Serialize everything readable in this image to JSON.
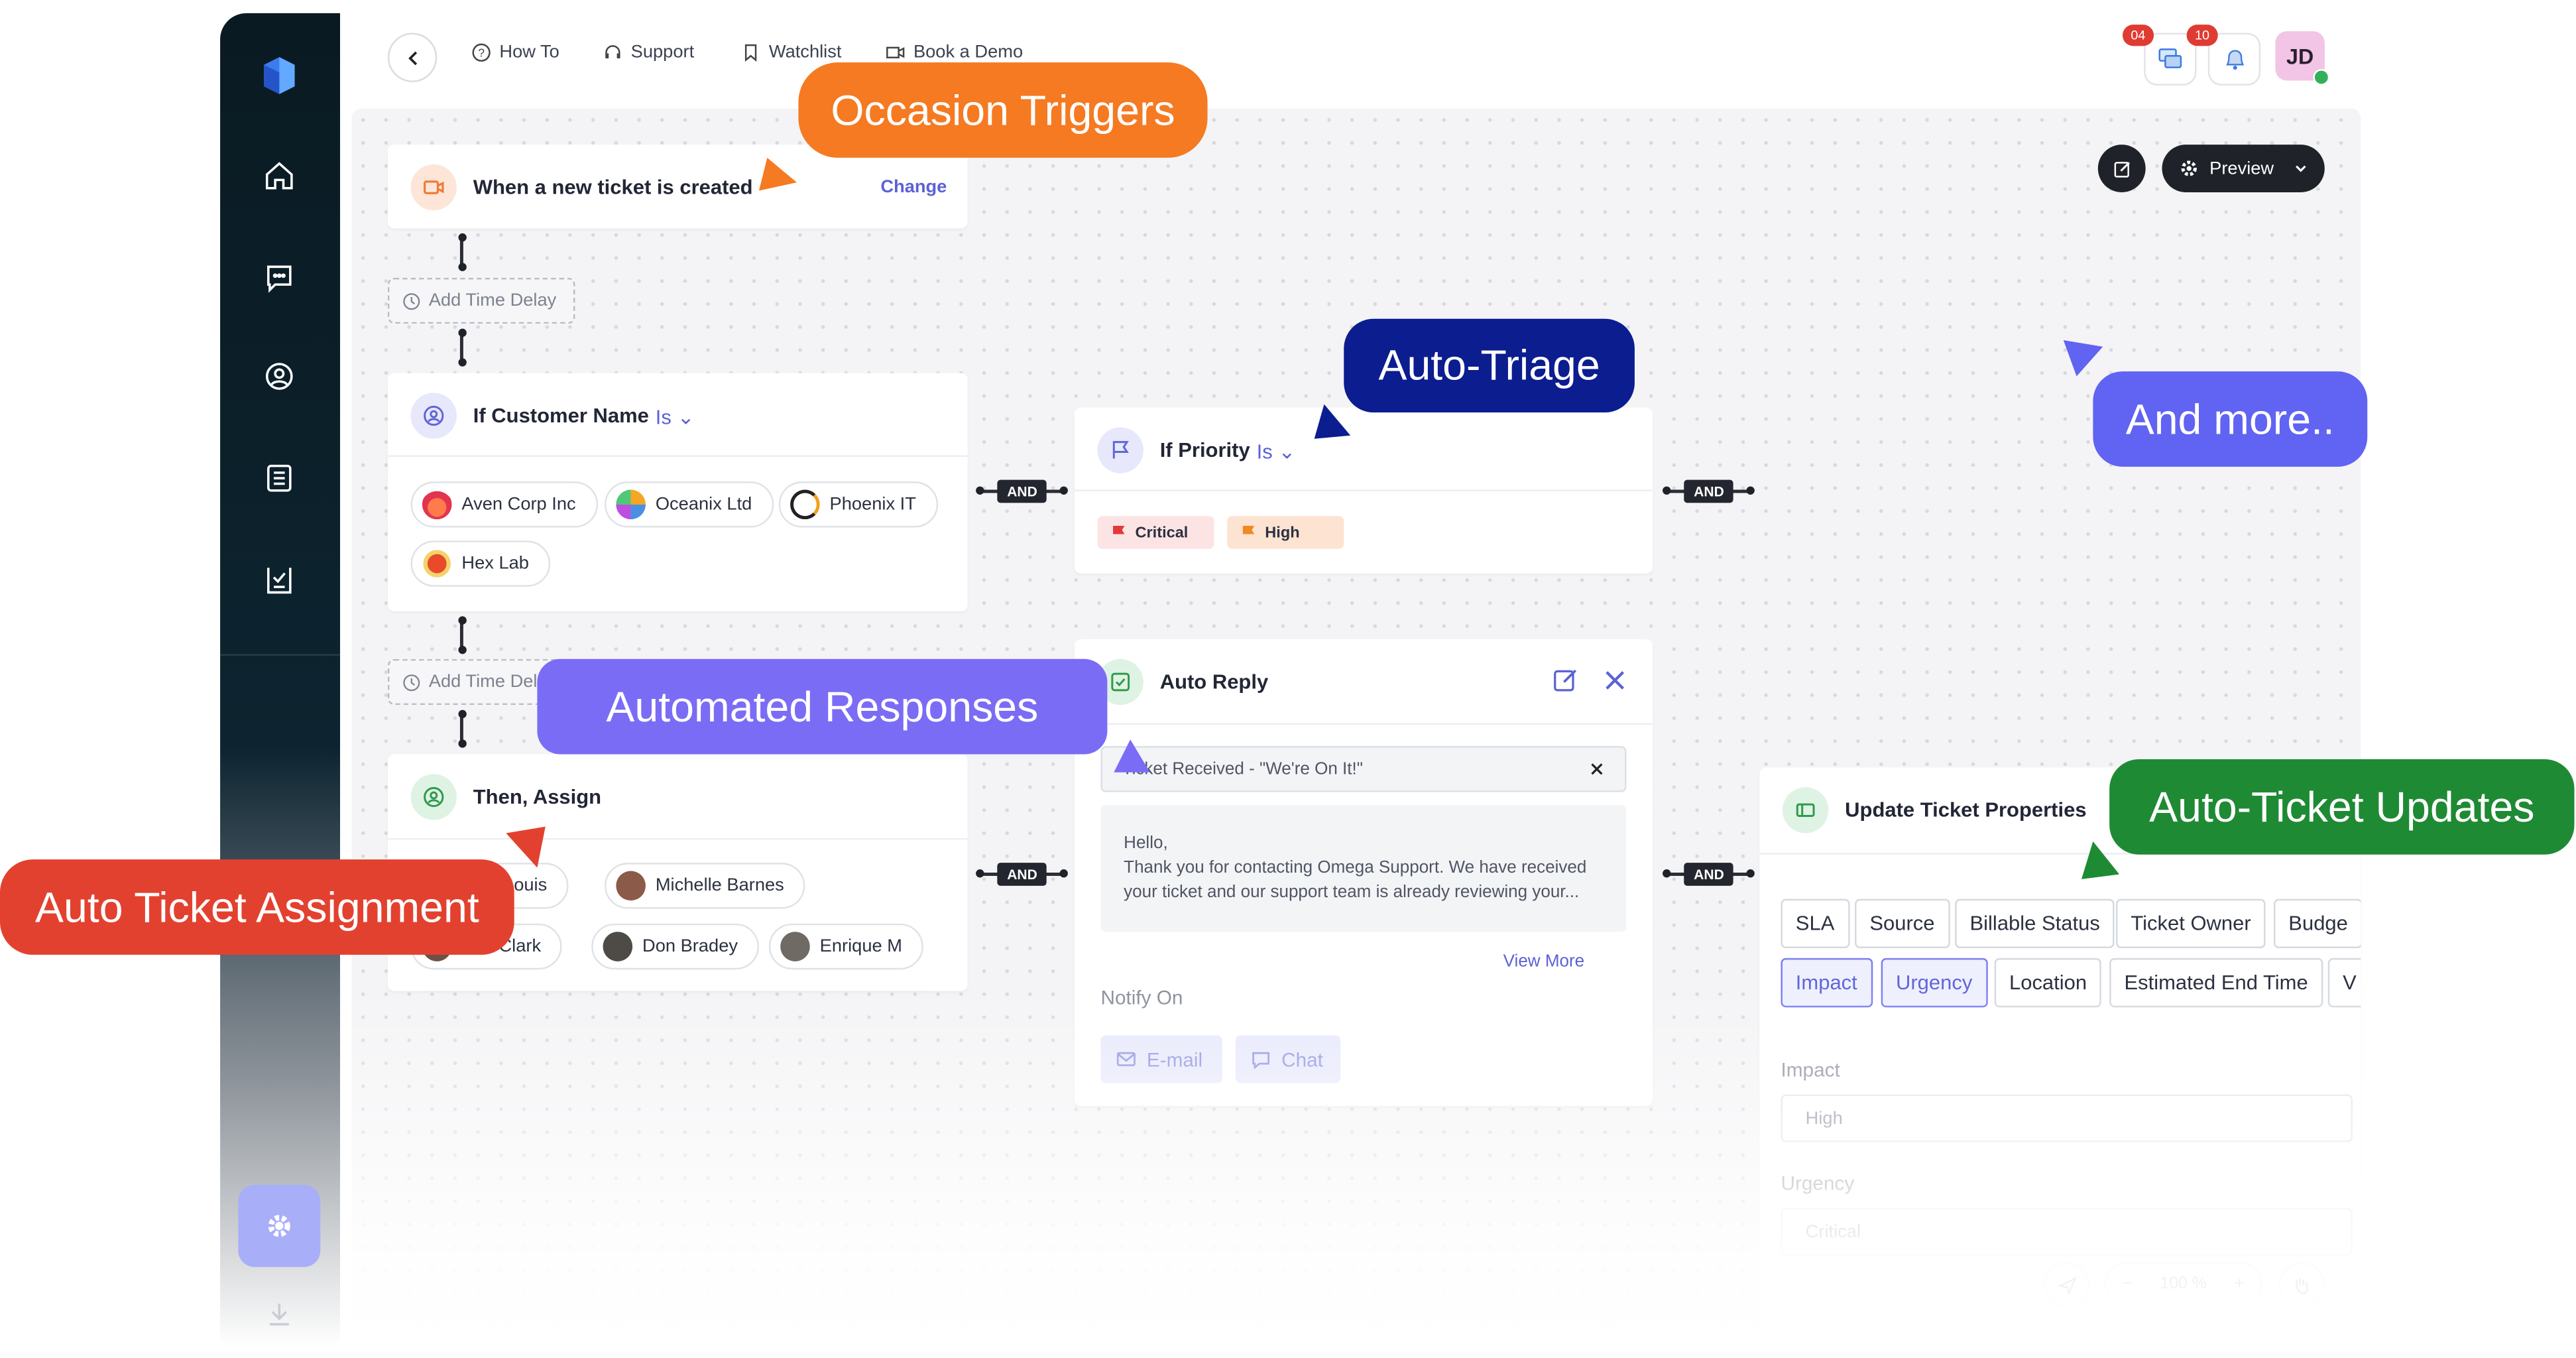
{
  "topbar": {
    "links": [
      "How To",
      "Support",
      "Watchlist",
      "Book a Demo"
    ],
    "chat_badge": "04",
    "notif_badge": "10",
    "avatar": "JD"
  },
  "canvas_toolbar": {
    "preview_label": "Preview"
  },
  "trigger": {
    "title": "When a new ticket is created",
    "change_label": "Change"
  },
  "time_delay": {
    "label_1": "Add Time Delay",
    "label_2": "Add Time Delay"
  },
  "customer_condition": {
    "prefix": "If Customer Name",
    "operator": "Is",
    "values": [
      "Aven Corp Inc",
      "Oceanix Ltd",
      "Phoenix IT",
      "Hex Lab"
    ]
  },
  "priority_condition": {
    "prefix": "If Priority",
    "operator": "Is",
    "values": [
      "Critical",
      "High"
    ]
  },
  "connector": {
    "and": "AND"
  },
  "assign": {
    "title": "Then, Assign",
    "agents": [
      "Ame Louis",
      "Michelle Barnes",
      "Ana Clark",
      "Don Bradey",
      "Enrique M"
    ]
  },
  "auto_reply": {
    "title": "Auto Reply",
    "template": "Ticket Received - \"We're On It!\"",
    "body_line1": "Hello,",
    "body_line2": "Thank you for contacting Omega Support. We have received",
    "body_line3": "your ticket and our support team is already reviewing your...",
    "view_more": "View More",
    "notify_label": "Notify On",
    "notify_options": [
      "E-mail",
      "Chat"
    ]
  },
  "update_props": {
    "title": "Update Ticket Properties",
    "row1": [
      "SLA",
      "Source",
      "Billable Status",
      "Ticket Owner",
      "Budge"
    ],
    "row2": [
      "Impact",
      "Urgency",
      "Location",
      "Estimated End Time",
      "V"
    ],
    "impact_label": "Impact",
    "impact_value": "High",
    "urgency_label": "Urgency",
    "urgency_value": "Critical",
    "zoom": "100 %"
  },
  "callouts": {
    "occasion": "Occasion Triggers",
    "triage": "Auto-Triage",
    "more": "And more..",
    "responses": "Automated Responses",
    "updates": "Auto-Ticket Updates",
    "assignment": "Auto Ticket Assignment"
  },
  "colors": {
    "occasion": "#f57a22",
    "triage": "#0b1d8f",
    "more": "#6163f2",
    "responses": "#7b6cf5",
    "updates": "#1f8a34",
    "assignment": "#e3412f"
  }
}
